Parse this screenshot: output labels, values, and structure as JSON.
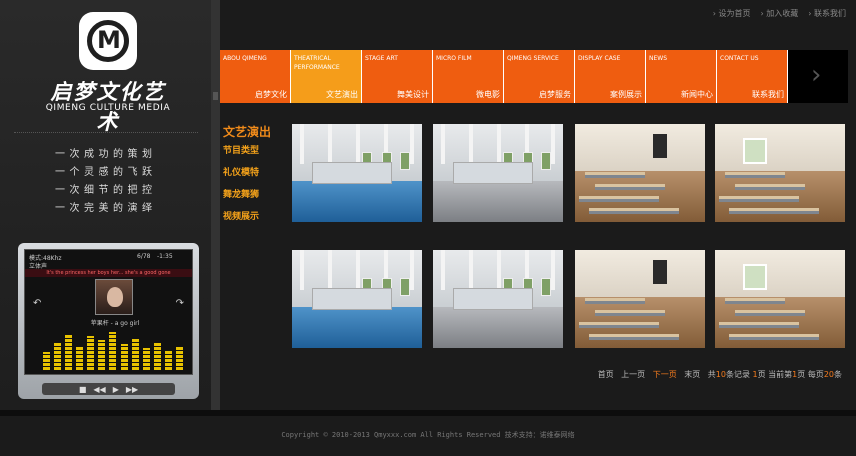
{
  "top_links": [
    "设为首页",
    "加入收藏",
    "联系我们"
  ],
  "brand": {
    "name_cn": "启梦文化艺术",
    "name_en": "QIMENG CULTURE MEDIA"
  },
  "slogans": [
    "一次成功的策划",
    "一个灵感的飞跃",
    "一次细节的把控",
    "一次完美的演绎"
  ],
  "player": {
    "mode": "模式:48Khz",
    "mode2": "立体声",
    "track_no": "6/78",
    "time": "-1:35",
    "banner": "It's the princess her boys her... she's a good gone",
    "song": "苹果杆 - a go girl",
    "eq_levels": [
      0.45,
      0.7,
      0.9,
      0.6,
      0.85,
      0.75,
      0.95,
      0.65,
      0.8,
      0.55,
      0.7,
      0.5,
      0.6
    ]
  },
  "nav": [
    {
      "en": "ABOU QIMENG",
      "cn": "启梦文化"
    },
    {
      "en": "THEATRICAL PERFORMANCE",
      "cn": "文艺演出",
      "active": true
    },
    {
      "en": "STAGE ART",
      "cn": "舞美设计"
    },
    {
      "en": "MICRO FILM",
      "cn": "微电影"
    },
    {
      "en": "QIMENG SERVICE",
      "cn": "启梦服务"
    },
    {
      "en": "DISPLAY CASE",
      "cn": "案例展示"
    },
    {
      "en": "NEWS",
      "cn": "新闻中心"
    },
    {
      "en": "CONTACT US",
      "cn": "联系我们"
    }
  ],
  "nav_next": "›",
  "submenu": {
    "title": "文艺演出",
    "items": [
      "节目类型",
      "礼仪模特",
      "舞龙舞狮",
      "视频展示"
    ]
  },
  "gallery": [
    "dance",
    "dance2",
    "classroom",
    "classroom2",
    "dance",
    "dance2",
    "classroom",
    "classroom2"
  ],
  "pager": {
    "first": "首页",
    "prev": "上一页",
    "next": "下一页",
    "last": "末页",
    "total_prefix": "共",
    "total": "10",
    "total_suffix": "条记录",
    "pages": "1",
    "pages_suffix": "页",
    "current_prefix": "当前第",
    "current": "1",
    "current_suffix": "页",
    "per_prefix": "每页",
    "per": "20",
    "per_suffix": "条"
  },
  "footer": "Copyright © 2010-2013 Qmyxxx.com All Rights Reserved  技术支持：诺维泰网络"
}
